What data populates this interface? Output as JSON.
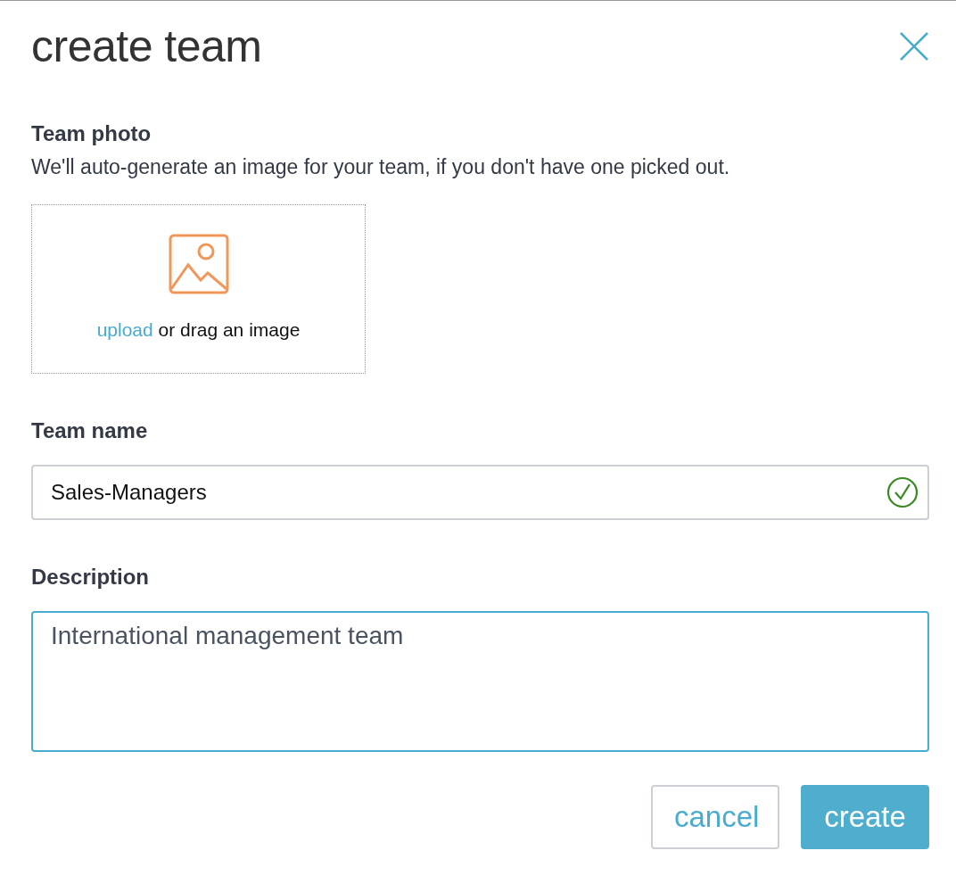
{
  "dialog": {
    "title": "create team"
  },
  "team_photo": {
    "label": "Team photo",
    "hint": "We'll auto-generate an image for your team, if you don't have one picked out.",
    "upload_link": "upload",
    "drop_text": "or drag an image"
  },
  "team_name": {
    "label": "Team name",
    "value": "Sales-Managers",
    "valid": true
  },
  "description": {
    "label": "Description",
    "value": "International management team",
    "focused": true
  },
  "buttons": [
    {
      "label": "cancel",
      "kind": "secondary"
    },
    {
      "label": "create",
      "kind": "primary"
    }
  ]
}
